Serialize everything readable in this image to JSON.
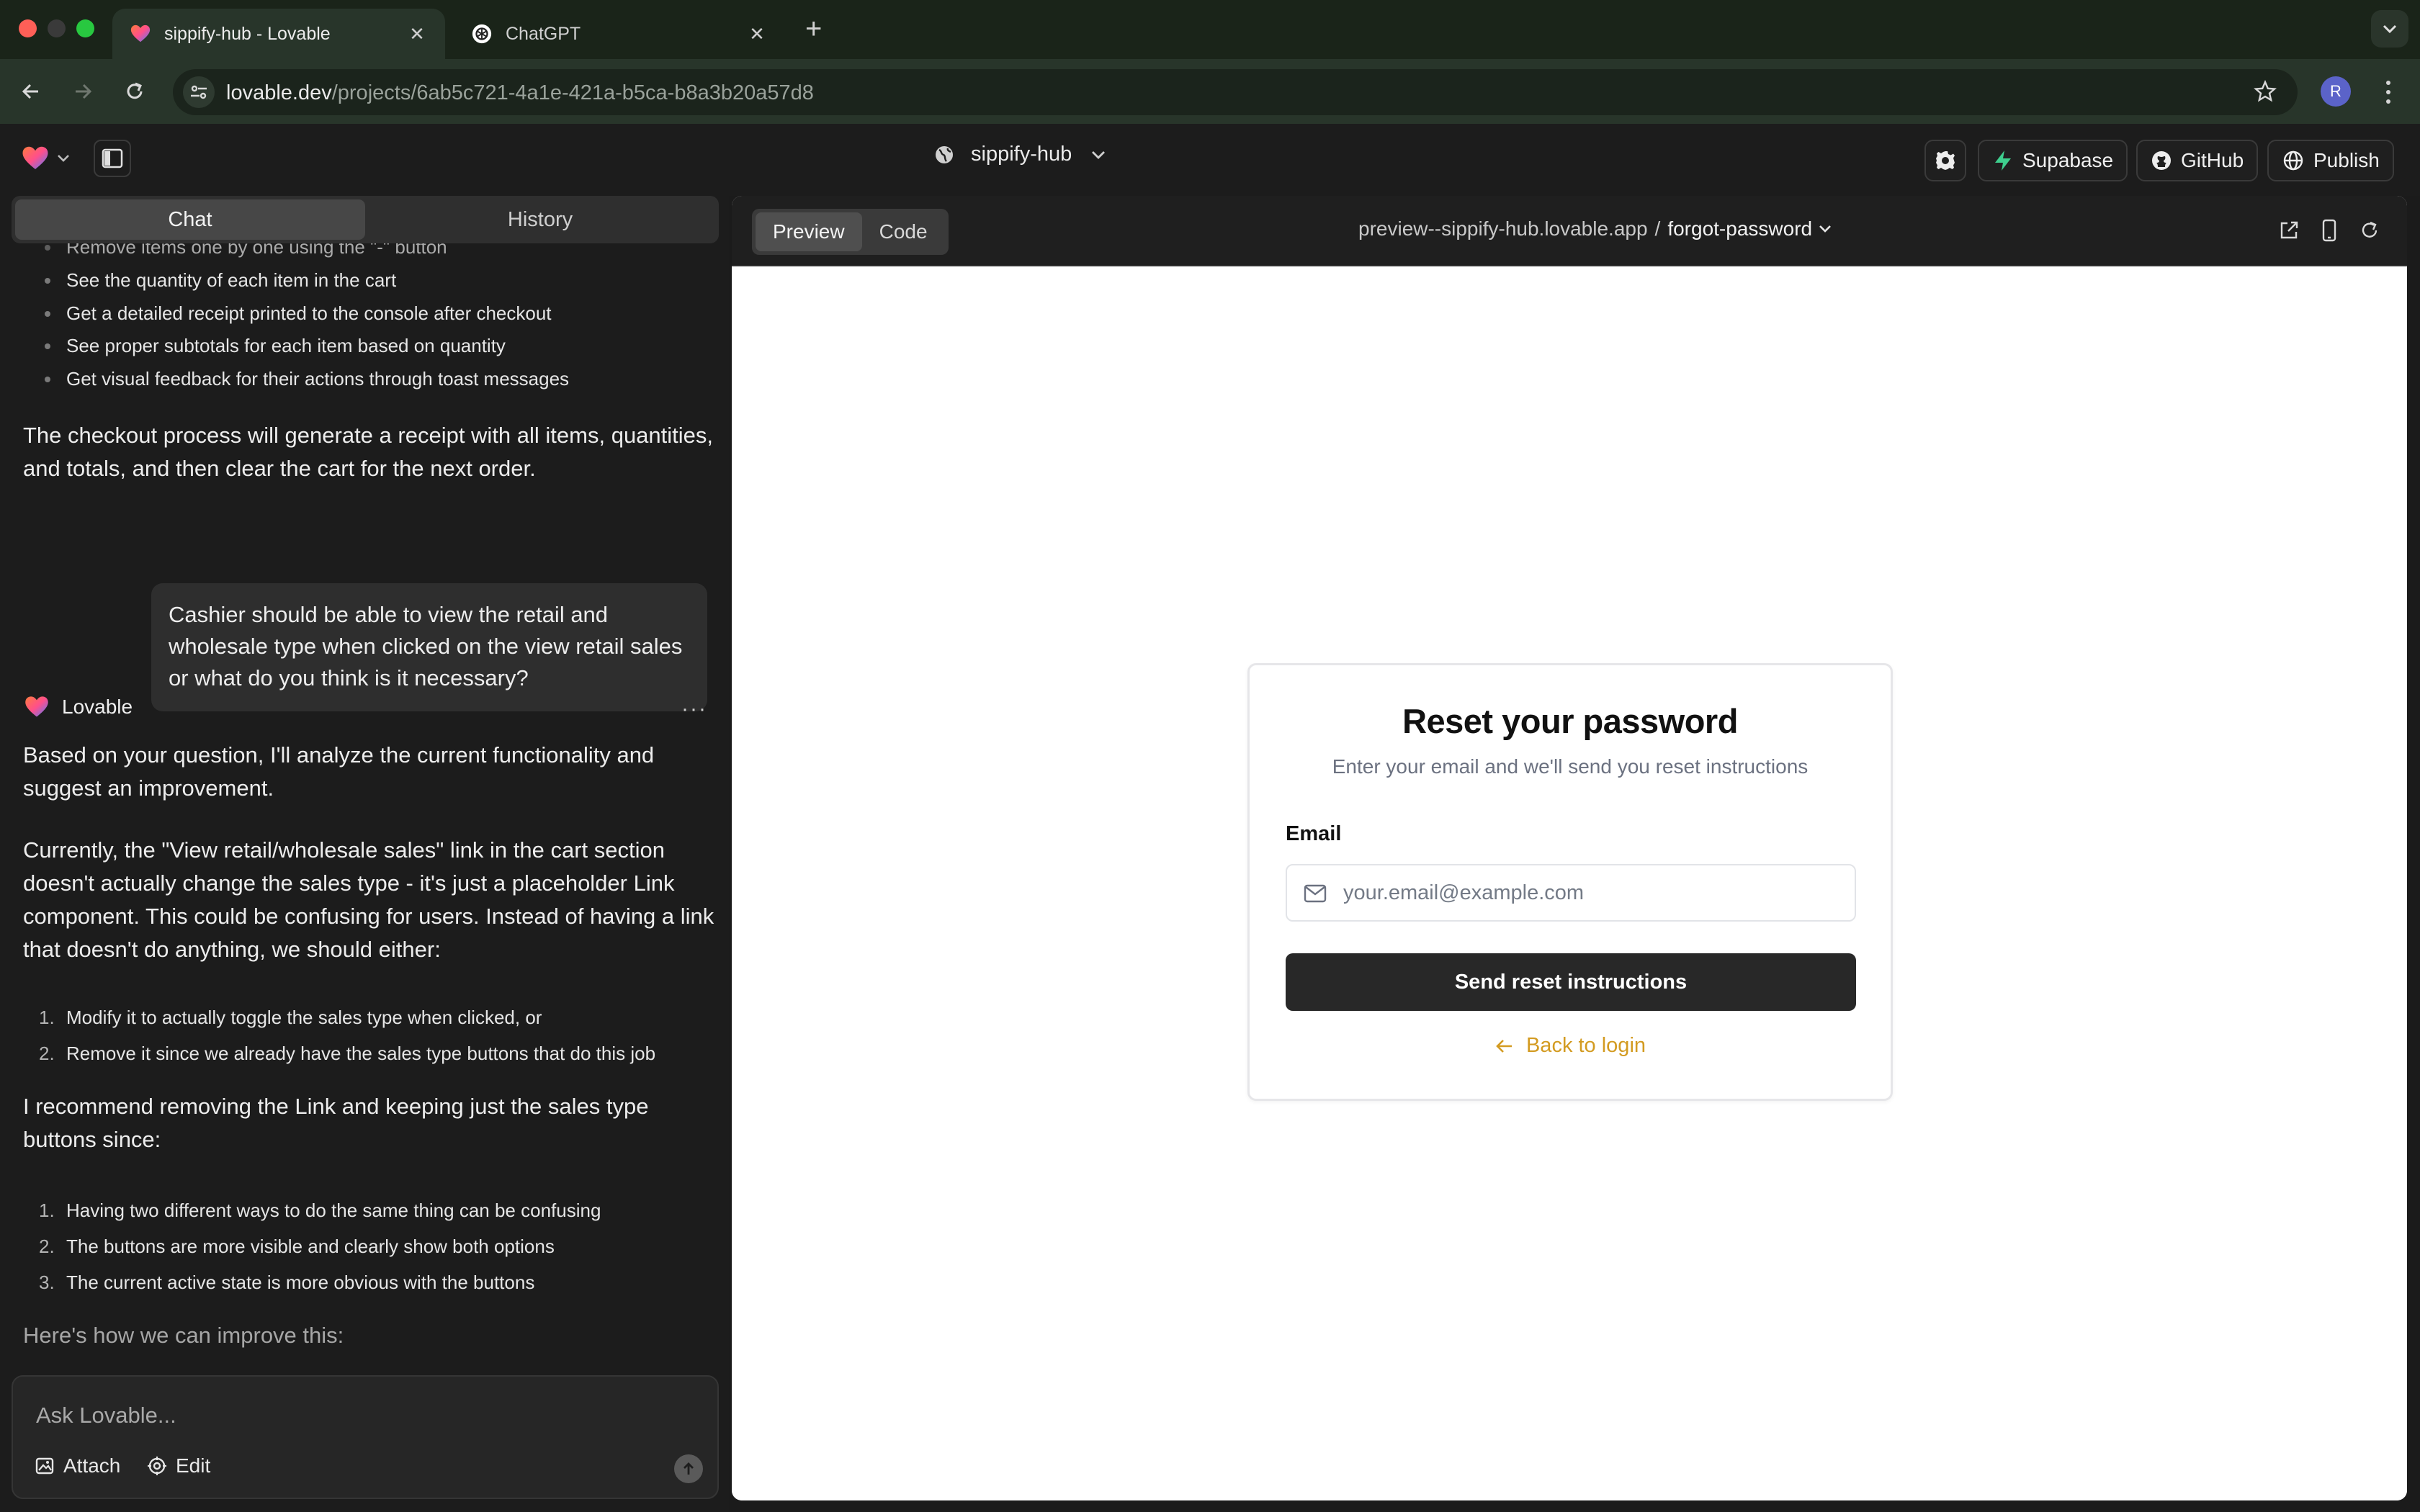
{
  "browser": {
    "tabs": [
      {
        "title": "sippify-hub - Lovable",
        "active": true
      },
      {
        "title": "ChatGPT",
        "active": false
      }
    ],
    "url_host": "lovable.dev",
    "url_path": "/projects/6ab5c721-4a1e-421a-b5ca-b8a3b20a57d8",
    "profile_initial": "R"
  },
  "header": {
    "project_name": "sippify-hub",
    "supabase_label": "Supabase",
    "github_label": "GitHub",
    "publish_label": "Publish"
  },
  "chat_panel": {
    "tabs": [
      "Chat",
      "History"
    ],
    "active_tab": "Chat",
    "top_bullets": [
      "Remove items one by one using the \"-\" button",
      "See the quantity of each item in the cart",
      "Get a detailed receipt printed to the console after checkout",
      "See proper subtotals for each item based on quantity",
      "Get visual feedback for their actions through toast messages"
    ],
    "checkout_paragraph": "The checkout process will generate a receipt with all items, quantities, and totals, and then clear the cart for the next order.",
    "user_message": "Cashier should be able to view the retail and wholesale type when clicked on the view retail sales or what do you think is it necessary?",
    "bot_name": "Lovable",
    "bot_para1": "Based on your question, I'll analyze the current functionality and suggest an improvement.",
    "bot_para2": "Currently, the \"View retail/wholesale sales\" link in the cart section doesn't actually change the sales type - it's just a placeholder Link component. This could be confusing for users. Instead of having a link that doesn't do anything, we should either:",
    "options": [
      "Modify it to actually toggle the sales type when clicked, or",
      "Remove it since we already have the sales type buttons that do this job"
    ],
    "bot_para3": "I recommend removing the Link and keeping just the sales type buttons since:",
    "reasons": [
      "Having two different ways to do the same thing can be confusing",
      "The buttons are more visible and clearly show both options",
      "The current active state is more obvious with the buttons"
    ],
    "bot_para4": "Here's how we can improve this:",
    "input_placeholder": "Ask Lovable...",
    "attach_label": "Attach",
    "edit_label": "Edit"
  },
  "preview_panel": {
    "mode_tabs": [
      "Preview",
      "Code"
    ],
    "active_mode": "Preview",
    "host": "preview--sippify-hub.lovable.app",
    "separator": "/",
    "route": "forgot-password"
  },
  "reset_form": {
    "title": "Reset your password",
    "subtitle": "Enter your email and we'll send you reset instructions",
    "email_label": "Email",
    "email_placeholder": "your.email@example.com",
    "email_value": "",
    "submit_label": "Send reset instructions",
    "back_label": "Back to login"
  },
  "colors": {
    "accent_link": "#d39b21",
    "primary_button": "#282828",
    "supabase_green": "#3ecf8e"
  }
}
